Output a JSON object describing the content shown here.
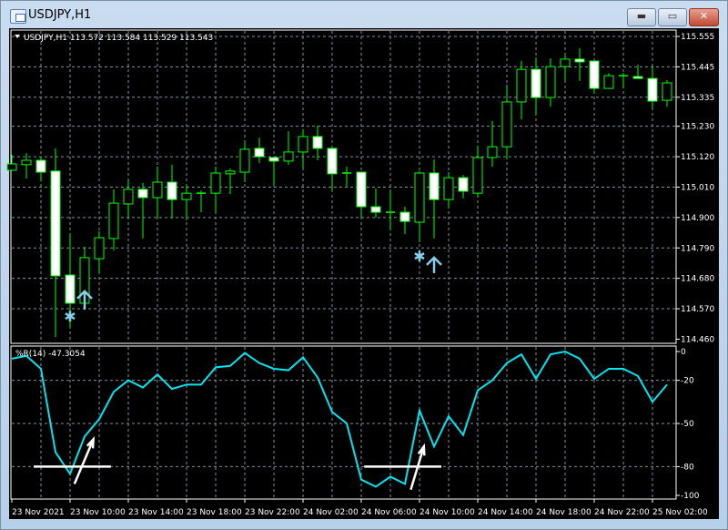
{
  "window": {
    "title": "USDJPY,H1",
    "buttons": [
      "minimize",
      "maximize",
      "close"
    ],
    "min_glyph": "▬",
    "max_glyph": "▭",
    "close_glyph": "✕"
  },
  "chart": {
    "header": "USDJPY,H1  113.572 113.584 113.529 113.543",
    "colors": {
      "background": "#000000",
      "candle_outline": "#00ff00",
      "bull_body": "#000000",
      "bear_body": "#ffffff",
      "grid": "#8090a0",
      "indicator_line": "#00e5ee",
      "marker": "#87ceeb",
      "drawing": "#ffffff"
    },
    "price_axis": [
      "115.555",
      "115.445",
      "115.335",
      "115.230",
      "115.120",
      "115.010",
      "114.900",
      "114.790",
      "114.680",
      "114.570",
      "114.460"
    ],
    "time_axis": [
      "23 Nov 2021",
      "23 Nov 10:00",
      "23 Nov 14:00",
      "23 Nov 18:00",
      "23 Nov 22:00",
      "24 Nov 02:00",
      "24 Nov 06:00",
      "24 Nov 10:00",
      "24 Nov 14:00",
      "24 Nov 18:00",
      "24 Nov 22:00",
      "25 Nov 02:00"
    ],
    "candles_ohlc": [
      [
        115.071,
        115.127,
        115.068,
        115.094
      ],
      [
        115.091,
        115.133,
        115.041,
        115.107
      ],
      [
        115.107,
        115.12,
        115.031,
        115.064
      ],
      [
        115.068,
        115.15,
        114.468,
        114.689
      ],
      [
        114.692,
        114.84,
        114.504,
        114.59
      ],
      [
        114.59,
        114.794,
        114.585,
        114.755
      ],
      [
        114.751,
        114.85,
        114.699,
        114.827
      ],
      [
        114.824,
        115.002,
        114.781,
        114.952
      ],
      [
        114.949,
        115.035,
        114.896,
        115.002
      ],
      [
        115.002,
        115.025,
        114.824,
        114.972
      ],
      [
        114.972,
        115.084,
        114.896,
        115.028
      ],
      [
        115.028,
        115.091,
        114.896,
        114.965
      ],
      [
        114.965,
        115.018,
        114.89,
        114.988
      ],
      [
        114.988,
        114.998,
        114.919,
        114.986
      ],
      [
        114.988,
        115.084,
        114.919,
        115.061
      ],
      [
        115.058,
        115.077,
        114.985,
        115.068
      ],
      [
        115.064,
        115.17,
        115.028,
        115.147
      ],
      [
        115.15,
        115.189,
        115.097,
        115.12
      ],
      [
        115.117,
        115.12,
        115.018,
        115.104
      ],
      [
        115.104,
        115.212,
        115.091,
        115.137
      ],
      [
        115.137,
        115.219,
        115.077,
        115.193
      ],
      [
        115.193,
        115.232,
        115.107,
        115.15
      ],
      [
        115.15,
        115.152,
        114.998,
        115.058
      ],
      [
        115.061,
        115.084,
        115.012,
        115.059
      ],
      [
        115.064,
        115.066,
        114.9,
        114.939
      ],
      [
        114.939,
        115.005,
        114.9,
        114.919
      ],
      [
        114.919,
        114.998,
        114.853,
        114.918
      ],
      [
        114.919,
        114.939,
        114.84,
        114.886
      ],
      [
        114.883,
        115.068,
        114.811,
        115.061
      ],
      [
        115.061,
        115.11,
        114.824,
        114.965
      ],
      [
        114.965,
        115.064,
        114.936,
        115.044
      ],
      [
        115.044,
        115.054,
        114.969,
        114.995
      ],
      [
        114.988,
        115.16,
        114.972,
        115.117
      ],
      [
        115.117,
        115.249,
        115.084,
        115.156
      ],
      [
        115.156,
        115.38,
        115.11,
        115.318
      ],
      [
        115.318,
        115.466,
        115.255,
        115.436
      ],
      [
        115.436,
        115.479,
        115.272,
        115.334
      ],
      [
        115.334,
        115.476,
        115.301,
        115.446
      ],
      [
        115.446,
        115.486,
        115.394,
        115.473
      ],
      [
        115.473,
        115.512,
        115.394,
        115.463
      ],
      [
        115.466,
        115.468,
        115.351,
        115.367
      ],
      [
        115.367,
        115.423,
        115.365,
        115.413
      ],
      [
        115.413,
        115.423,
        115.367,
        115.412
      ],
      [
        115.41,
        115.453,
        115.403,
        115.403
      ],
      [
        115.403,
        115.446,
        115.295,
        115.321
      ],
      [
        115.324,
        115.397,
        115.301,
        115.387
      ]
    ],
    "markers": [
      {
        "type": "star",
        "candle": 4,
        "price": 114.544
      },
      {
        "type": "arrow-up",
        "candle": 5,
        "tip": 114.633,
        "tail": 114.567
      },
      {
        "type": "star",
        "candle": 28,
        "price": 114.761
      },
      {
        "type": "arrow-up",
        "candle": 29,
        "tip": 114.755,
        "tail": 114.699
      }
    ]
  },
  "indicator": {
    "label": "%R(14) -47.3054",
    "axis": [
      "0",
      "-20",
      "-50",
      "-80",
      "-100"
    ],
    "values": [
      -5,
      -3,
      -12,
      -70,
      -85,
      -59,
      -47,
      -28,
      -20,
      -25,
      -16,
      -26,
      -23,
      -23,
      -11,
      -10,
      -1,
      -8,
      -12,
      -13,
      -4,
      -18,
      -42,
      -50,
      -89,
      -94,
      -87,
      -92,
      -41,
      -66,
      -45,
      -58,
      -27,
      -20,
      -8,
      -2,
      -19,
      -2,
      0,
      -5,
      -19,
      -12,
      -12,
      -17,
      -35,
      -23
    ],
    "drawings": [
      {
        "type": "hline",
        "value": -80,
        "from": 1.5,
        "to": 6.8
      },
      {
        "type": "arrow",
        "from": [
          4.3,
          -92
        ],
        "to": [
          5.6,
          -61
        ]
      },
      {
        "type": "hline",
        "value": -80,
        "from": 24.2,
        "to": 29.5
      },
      {
        "type": "arrow",
        "from": [
          27.4,
          -96
        ],
        "to": [
          28.3,
          -66
        ]
      }
    ]
  }
}
